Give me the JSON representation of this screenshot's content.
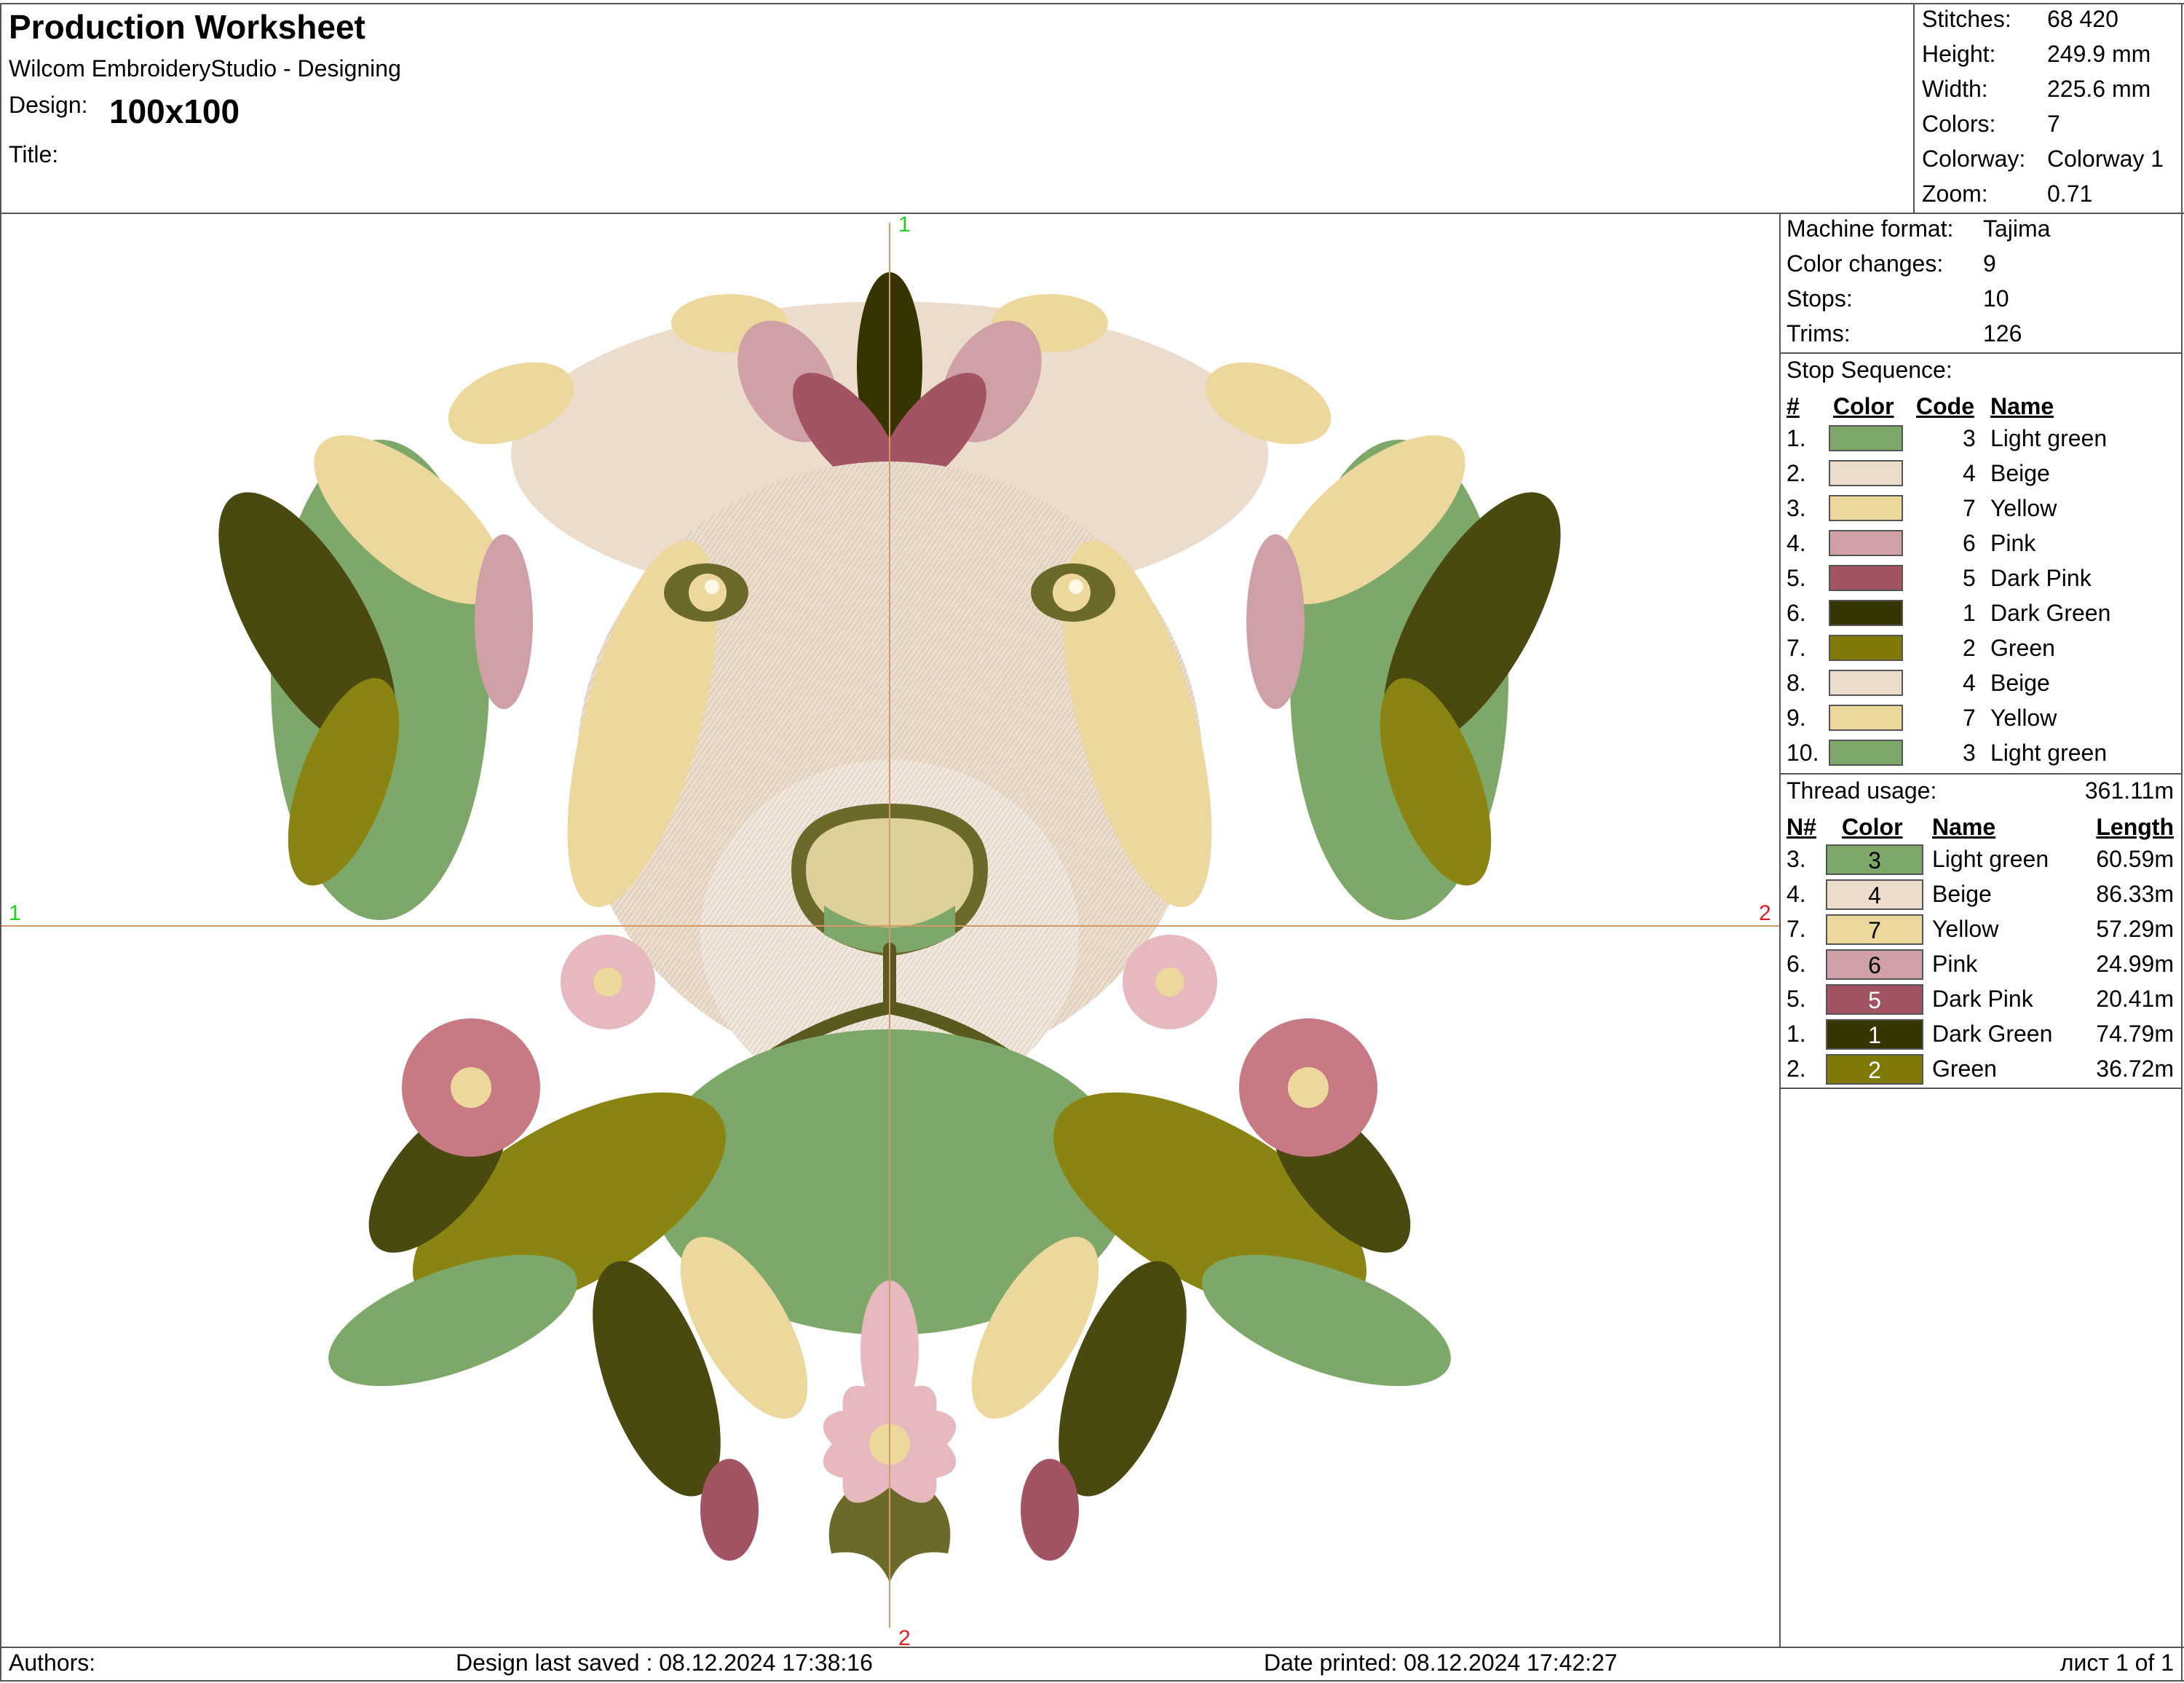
{
  "header": {
    "title": "Production Worksheet",
    "app": "Wilcom EmbroideryStudio - Designing",
    "design_label": "Design:",
    "design_value": "100x100",
    "title_label": "Title:"
  },
  "stats": [
    {
      "label": "Stitches:",
      "value": "68 420"
    },
    {
      "label": "Height:",
      "value": "249.9 mm"
    },
    {
      "label": "Width:",
      "value": "225.6 mm"
    },
    {
      "label": "Colors:",
      "value": "7"
    },
    {
      "label": "Colorway:",
      "value": "Colorway 1"
    },
    {
      "label": "Zoom:",
      "value": "0.71"
    }
  ],
  "machine": [
    {
      "label": "Machine format:",
      "value": "Tajima"
    },
    {
      "label": "Color changes:",
      "value": "9"
    },
    {
      "label": "Stops:",
      "value": "10"
    },
    {
      "label": "Trims:",
      "value": "126"
    }
  ],
  "stop_sequence": {
    "title": "Stop Sequence:",
    "headers": [
      "#",
      "Color",
      "Code",
      "Name"
    ],
    "rows": [
      {
        "n": "1.",
        "color": "#7ea86a",
        "code": "3",
        "name": "Light green"
      },
      {
        "n": "2.",
        "color": "#ecdccb",
        "code": "4",
        "name": "Beige"
      },
      {
        "n": "3.",
        "color": "#ecd89c",
        "code": "7",
        "name": "Yellow"
      },
      {
        "n": "4.",
        "color": "#cfa0a6",
        "code": "6",
        "name": "Pink"
      },
      {
        "n": "5.",
        "color": "#a35462",
        "code": "5",
        "name": "Dark Pink"
      },
      {
        "n": "6.",
        "color": "#363400",
        "code": "1",
        "name": "Dark Green"
      },
      {
        "n": "7.",
        "color": "#7f7a08",
        "code": "2",
        "name": "Green"
      },
      {
        "n": "8.",
        "color": "#ecdccb",
        "code": "4",
        "name": "Beige"
      },
      {
        "n": "9.",
        "color": "#ecd89c",
        "code": "7",
        "name": "Yellow"
      },
      {
        "n": "10.",
        "color": "#7ea86a",
        "code": "3",
        "name": "Light green"
      }
    ]
  },
  "thread_usage": {
    "title": "Thread usage:",
    "total": "361.11m",
    "headers": [
      "N#",
      "Color",
      "Name",
      "Length"
    ],
    "rows": [
      {
        "n": "3.",
        "color": "#7ea86a",
        "code": "3",
        "name": "Light green",
        "length": "60.59m",
        "textColor": "#000"
      },
      {
        "n": "4.",
        "color": "#ecdccb",
        "code": "4",
        "name": "Beige",
        "length": "86.33m",
        "textColor": "#000"
      },
      {
        "n": "7.",
        "color": "#ecd89c",
        "code": "7",
        "name": "Yellow",
        "length": "57.29m",
        "textColor": "#000"
      },
      {
        "n": "6.",
        "color": "#cfa0a6",
        "code": "6",
        "name": "Pink",
        "length": "24.99m",
        "textColor": "#000"
      },
      {
        "n": "5.",
        "color": "#a35462",
        "code": "5",
        "name": "Dark Pink",
        "length": "20.41m",
        "textColor": "#fff"
      },
      {
        "n": "1.",
        "color": "#363400",
        "code": "1",
        "name": "Dark Green",
        "length": "74.79m",
        "textColor": "#fff"
      },
      {
        "n": "2.",
        "color": "#7f7a08",
        "code": "2",
        "name": "Green",
        "length": "36.72m",
        "textColor": "#fff"
      }
    ]
  },
  "crosshair": {
    "top": "1",
    "bottom": "2",
    "left": "1",
    "right": "2"
  },
  "footer": {
    "authors": "Authors:",
    "saved": "Design last saved : 08.12.2024 17:38:16",
    "printed": "Date printed: 08.12.2024 17:42:27",
    "page": "лист 1 of 1"
  }
}
